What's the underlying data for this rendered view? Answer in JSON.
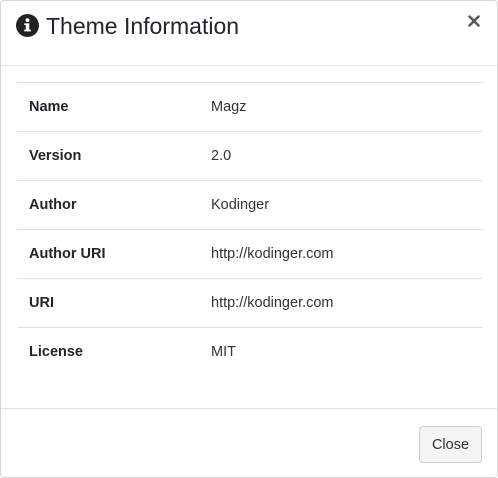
{
  "modal": {
    "title": "Theme Information",
    "title_icon": "info-circle-icon",
    "close_icon_glyph": "×",
    "close_button_label": "Close"
  },
  "details": [
    {
      "key": "Name",
      "value": "Magz"
    },
    {
      "key": "Version",
      "value": "2.0"
    },
    {
      "key": "Author",
      "value": "Kodinger"
    },
    {
      "key": "Author URI",
      "value": "http://kodinger.com"
    },
    {
      "key": "URI",
      "value": "http://kodinger.com"
    },
    {
      "key": "License",
      "value": "MIT"
    }
  ],
  "colors": {
    "text": "#212529",
    "border": "#dee2e6",
    "button_bg": "#f4f4f4"
  }
}
